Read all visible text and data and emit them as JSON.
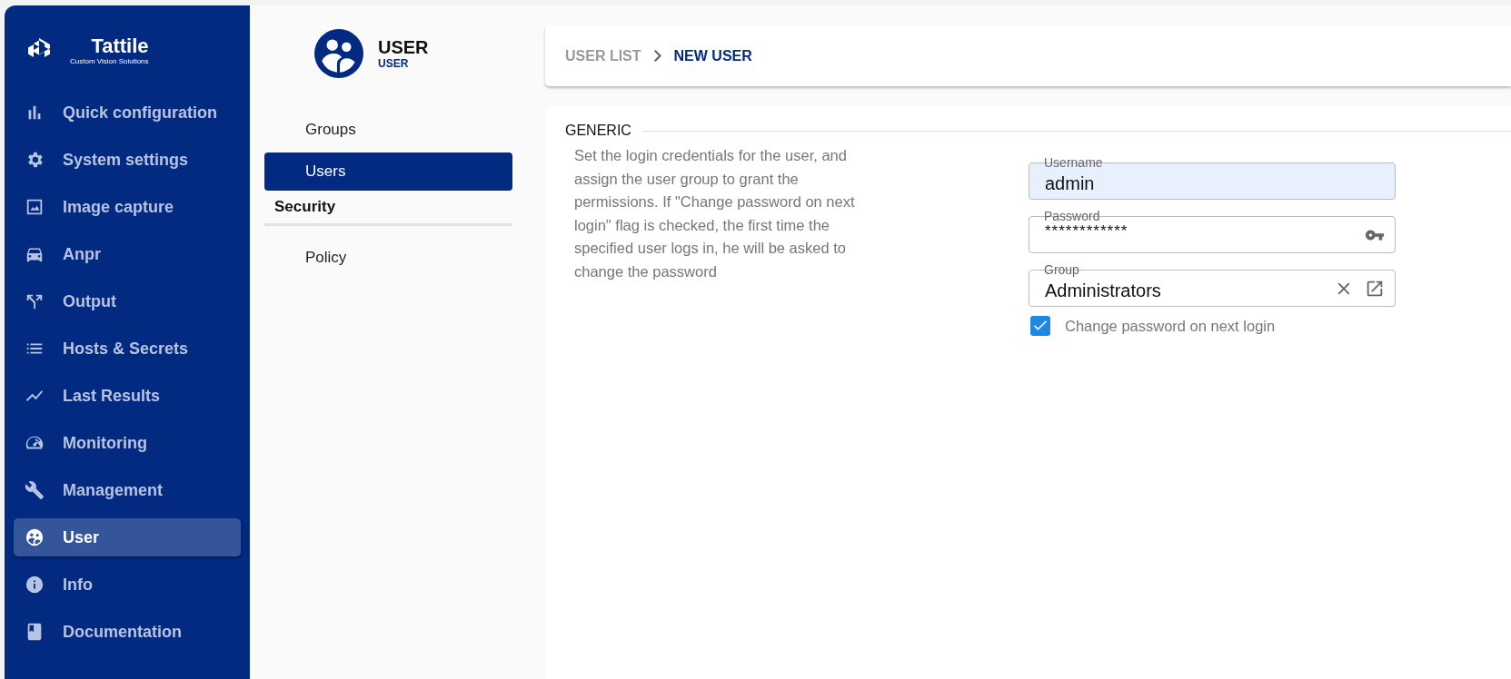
{
  "sidebar": {
    "logo": {
      "name": "Tattile",
      "tagline": "Custom Vision Solutions"
    },
    "items": [
      {
        "label": "Quick configuration",
        "selected": false
      },
      {
        "label": "System settings",
        "selected": false
      },
      {
        "label": "Image capture",
        "selected": false
      },
      {
        "label": "Anpr",
        "selected": false
      },
      {
        "label": "Output",
        "selected": false
      },
      {
        "label": "Hosts & Secrets",
        "selected": false
      },
      {
        "label": "Last Results",
        "selected": false
      },
      {
        "label": "Monitoring",
        "selected": false
      },
      {
        "label": "Management",
        "selected": false
      },
      {
        "label": "User",
        "selected": true
      },
      {
        "label": "Info",
        "selected": false
      },
      {
        "label": "Documentation",
        "selected": false
      }
    ]
  },
  "subnav": {
    "title": "USER",
    "subtitle": "USER",
    "sections": [
      {
        "items": [
          {
            "label": "Groups",
            "selected": false
          },
          {
            "label": "Users",
            "selected": true
          }
        ]
      },
      {
        "heading": "Security",
        "items": [
          {
            "label": "Policy",
            "selected": false
          }
        ]
      }
    ]
  },
  "breadcrumb": [
    {
      "label": "USER LIST",
      "current": false
    },
    {
      "label": "NEW USER",
      "current": true
    }
  ],
  "form": {
    "section": "GENERIC",
    "description": "Set the login credentials for the user, and assign the user group to grant the permissions. If \"Change password on next login\" flag is checked, the first time the specified user logs in, he will be asked to change the password",
    "fields": [
      {
        "kind": "text",
        "label": "Username",
        "value": "admin",
        "autofilled": true
      },
      {
        "kind": "password",
        "label": "Password",
        "value": "************",
        "autofilled": false
      },
      {
        "kind": "select",
        "label": "Group",
        "value": "Administrators",
        "autofilled": false
      }
    ],
    "checkbox": {
      "label": "Change password on next login",
      "checked": true
    }
  }
}
